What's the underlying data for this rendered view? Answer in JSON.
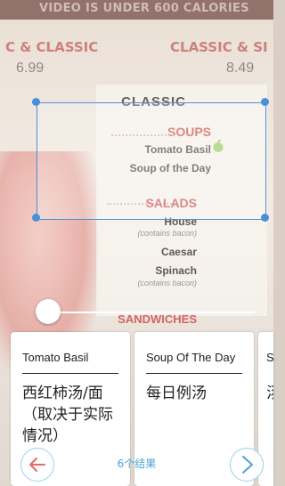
{
  "background_menu": {
    "banner": "VIDEO IS UNDER 600 CALORIES",
    "left_col_title": "C & CLASSIC",
    "left_price": "6.99",
    "right_col_title": "CLASSIC & SI",
    "right_price": "8.49",
    "section_title": "CLASSIC",
    "soups_heading": "SOUPS",
    "soup_1": "Tomato Basil",
    "soup_2": "Soup of the Day",
    "salads_heading": "SALADS",
    "salad_1": "House",
    "salad_1_note": "(contains bacon)",
    "salad_2": "Caesar",
    "salad_3": "Spinach",
    "salad_3_note": "(contains bacon)",
    "sandwiches_heading": "SANDWICHES"
  },
  "cards": [
    {
      "source": "Tomato Basil",
      "translation": "西红柿汤/面（取决于实际情况）"
    },
    {
      "source": "Soup Of The Day",
      "translation": "每日例汤"
    },
    {
      "source": "S",
      "translation": "汤"
    }
  ],
  "footer": {
    "results_label": "6个结果",
    "prev_icon": "back-arrow-icon",
    "next_icon": "chevron-right-icon"
  },
  "colors": {
    "accent": "#4a90d9",
    "results_text": "#4aa3d8",
    "prev_icon": "#e26b6b",
    "next_icon": "#4aa3d8"
  },
  "slider": {
    "value": 0
  }
}
